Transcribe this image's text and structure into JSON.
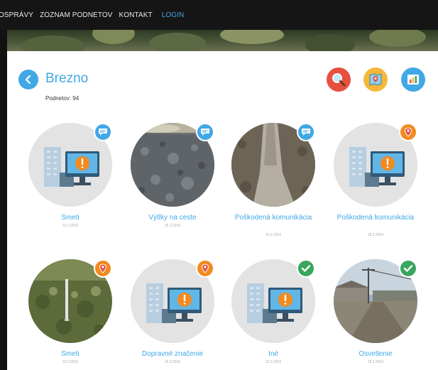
{
  "nav": {
    "items": [
      "OSPRÁVY",
      "ZOZNAM PODNETOV",
      "KONTAKT"
    ],
    "login": "LOGIN"
  },
  "header": {
    "city": "Brezno",
    "count": "Podnetov: 94"
  },
  "tools": [
    "search-icon",
    "map-icon",
    "chart-icon"
  ],
  "colors": {
    "accent": "#41a8e6",
    "search": "#e7503f",
    "map": "#f6b83a",
    "chart": "#41a8e6",
    "status_blue": "#41a8e6",
    "status_orange": "#f28a1e",
    "status_green": "#3aa55d"
  },
  "cards": [
    {
      "title": "Smeti",
      "date": "15.2.2016",
      "status": "comment-icon",
      "image": "placeholder"
    },
    {
      "title": "Výtlky na ceste",
      "date": "15.2.2016",
      "status": "comment-icon",
      "image": "gravel-photo"
    },
    {
      "title": "Poškodená komunikácia",
      "date": "15.2.2016",
      "status": "comment-icon",
      "image": "road-photo"
    },
    {
      "title": "Poškodená komunikácia",
      "date": "15.2.2016",
      "status": "location-icon",
      "image": "placeholder"
    },
    {
      "title": "Smeti",
      "date": "15.2.2016",
      "status": "location-icon",
      "image": "grass-photo"
    },
    {
      "title": "Dopravné značenie",
      "date": "15.2.2016",
      "status": "location-icon",
      "image": "placeholder"
    },
    {
      "title": "Iné",
      "date": "15.2.2016",
      "status": "check-icon",
      "image": "placeholder"
    },
    {
      "title": "Osvetlenie",
      "date": "15.2.2016",
      "status": "check-icon",
      "image": "street-photo"
    }
  ]
}
